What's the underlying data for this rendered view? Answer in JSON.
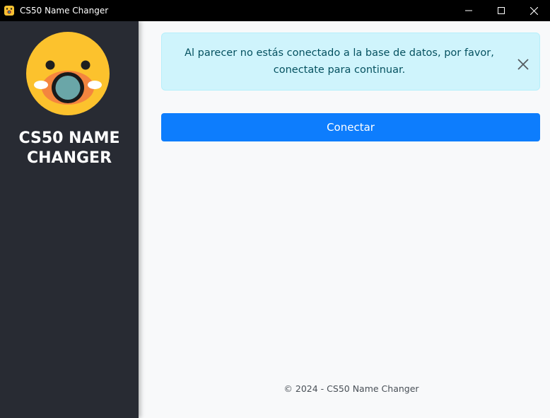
{
  "window": {
    "title": "CS50 Name Changer",
    "app_icon": "screaming-face-icon",
    "controls": [
      "minimize-icon",
      "maximize-icon",
      "close-icon"
    ]
  },
  "sidebar": {
    "logo_icon": "screaming-face-icon",
    "title_line1": "CS50 NAME",
    "title_line2": "CHANGER"
  },
  "main": {
    "alert": {
      "message": "Al parecer no estás conectado a la base de datos, por favor, conectate para continuar.",
      "close_icon": "close-icon"
    },
    "connect_button": "Conectar",
    "footer": "© 2024 - CS50 Name Changer"
  },
  "colors": {
    "titlebar": "#000000",
    "sidebar": "#282b33",
    "main_bg": "#f8f9fa",
    "alert_bg": "#cff4fc",
    "alert_border": "#b6effb",
    "alert_text": "#055160",
    "primary_button": "#0d7dfd"
  }
}
